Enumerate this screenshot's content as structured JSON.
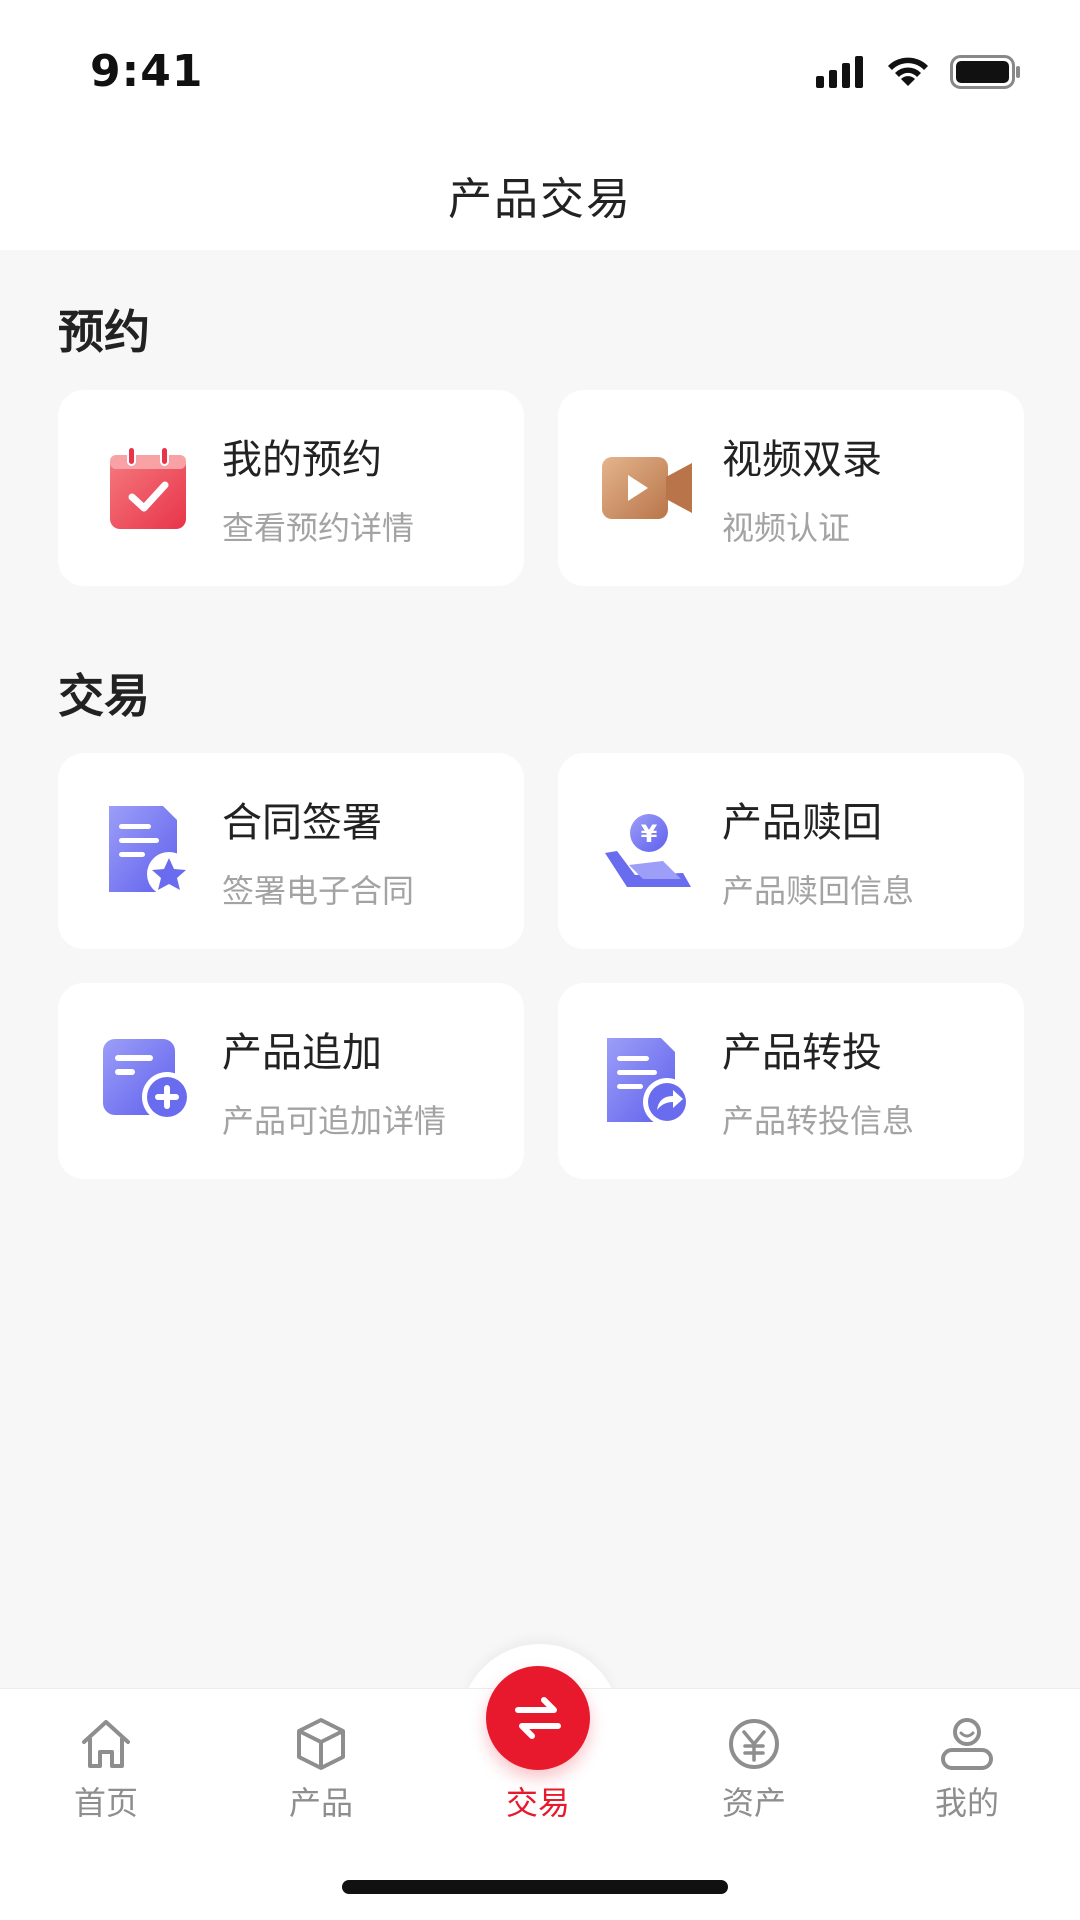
{
  "status_bar": {
    "time": "9:41"
  },
  "nav": {
    "title": "产品交易"
  },
  "sections": {
    "booking": {
      "title": "预约",
      "items": [
        {
          "title": "我的预约",
          "subtitle": "查看预约详情",
          "icon": "calendar-check-icon"
        },
        {
          "title": "视频双录",
          "subtitle": "视频认证",
          "icon": "video-camera-icon"
        }
      ]
    },
    "trade": {
      "title": "交易",
      "items": [
        {
          "title": "合同签署",
          "subtitle": "签署电子合同",
          "icon": "contract-star-icon"
        },
        {
          "title": "产品赎回",
          "subtitle": "产品赎回信息",
          "icon": "hand-yuan-icon"
        },
        {
          "title": "产品追加",
          "subtitle": "产品可追加详情",
          "icon": "document-plus-icon"
        },
        {
          "title": "产品转投",
          "subtitle": "产品转投信息",
          "icon": "document-share-icon"
        }
      ]
    }
  },
  "tab_bar": {
    "tabs": [
      {
        "label": "首页",
        "icon": "home-icon"
      },
      {
        "label": "产品",
        "icon": "box-icon"
      },
      {
        "label": "交易",
        "icon": "exchange-icon",
        "active": true
      },
      {
        "label": "资产",
        "icon": "yuan-circle-icon"
      },
      {
        "label": "我的",
        "icon": "user-icon"
      }
    ]
  },
  "colors": {
    "accent": "#e8192c",
    "calendar_red": "#ef4a55",
    "video_brown": "#c98a5d",
    "purple": "#7073f0"
  }
}
